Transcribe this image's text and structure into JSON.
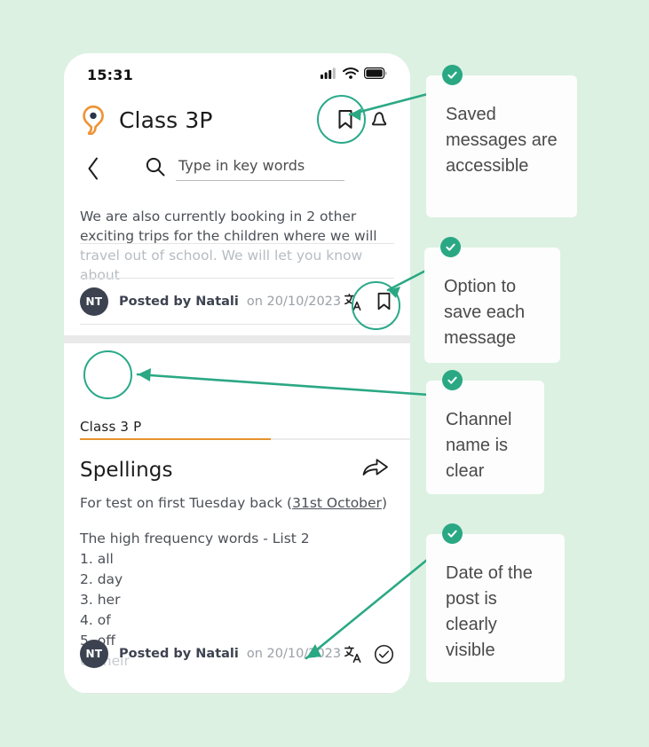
{
  "theme": {
    "page_background": "#dcf1e2",
    "accent_teal": "#2aa884",
    "accent_orange": "#e8922d",
    "avatar_bg": "#3c4250",
    "text_dark": "#1d1d1d",
    "text_body": "#4c5057",
    "text_muted": "#9aa0a6"
  },
  "phone": {
    "status_bar": {
      "time": "15:31",
      "icons": [
        "cellular-signal-icon",
        "wifi-icon",
        "battery-icon"
      ]
    },
    "header": {
      "logo_icon": "location-pin-icon",
      "title": "Class 3P",
      "actions": [
        {
          "icon": "bookmark-icon",
          "name": "saved-messages-button"
        },
        {
          "icon": "bell-icon",
          "name": "notifications-button"
        }
      ]
    },
    "search_row": {
      "back_icon": "chevron-left-icon",
      "search_icon": "search-icon",
      "placeholder": "Type in key words",
      "value": ""
    },
    "message_one": {
      "lines": [
        "We are also currently booking in 2 other",
        "exciting trips for the children where we will",
        "travel out of school. We will let you know about"
      ],
      "footer": {
        "avatar_initials": "NT",
        "posted_by": "Posted by Natali",
        "posted_on": "on 20/10/2023",
        "actions": [
          {
            "icon": "translate-icon",
            "name": "translate-button"
          },
          {
            "icon": "bookmark-icon",
            "name": "save-message-button"
          }
        ]
      }
    },
    "message_two": {
      "channel_name": "Class 3 P",
      "title": "Spellings",
      "share_icon": "share-arrow-icon",
      "subtitle_prefix": "For test on first Tuesday back (",
      "subtitle_link": "31st October",
      "subtitle_suffix": ")",
      "list_heading": "The high frequency words - List 2",
      "list_items": [
        {
          "text": "1. all",
          "faded": false
        },
        {
          "text": "2. day",
          "faded": false
        },
        {
          "text": "3. her",
          "faded": false
        },
        {
          "text": "4. of",
          "faded": false
        },
        {
          "text": "5. off",
          "faded": false
        },
        {
          "text": "6. their",
          "faded": true
        }
      ],
      "footer": {
        "avatar_initials": "NT",
        "posted_by": "Posted by Natali",
        "posted_on": "on 20/10/2023",
        "actions": [
          {
            "icon": "translate-icon",
            "name": "translate-button"
          },
          {
            "icon": "check-circle-icon",
            "name": "read-receipt-button"
          }
        ]
      }
    }
  },
  "annotations": [
    {
      "id": "note-saved-messages",
      "text": "Saved messages are accessible"
    },
    {
      "id": "note-save-each-message",
      "text": "Option to save each message"
    },
    {
      "id": "note-channel-name",
      "text": "Channel name is clear"
    },
    {
      "id": "note-date-visible",
      "text": "Date of the post is clearly visible"
    }
  ]
}
